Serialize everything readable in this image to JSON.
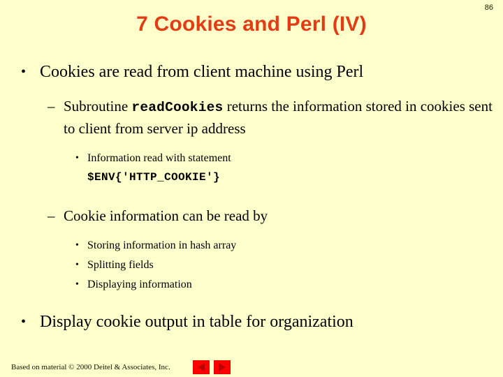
{
  "slide": {
    "page_number": "86",
    "title": "7 Cookies and Perl (IV)",
    "background_color": "#ffffcc",
    "title_color": "#e23c14",
    "text_color": "#000000"
  },
  "content": {
    "bullet1": {
      "marker": "•",
      "text": "Cookies are read from client machine using Perl"
    },
    "bullet1_sub1": {
      "marker": "–",
      "text_before": "Subroutine ",
      "code": "readCookies",
      "text_after": " returns the information stored in cookies sent to client from server ip address"
    },
    "bullet1_sub1_sub1": {
      "marker": "•",
      "text": "Information read with statement"
    },
    "bullet1_sub1_code": {
      "code": "$ENV{'HTTP_COOKIE'}"
    },
    "bullet1_sub2": {
      "marker": "–",
      "text": "Cookie information can be read by"
    },
    "bullet1_sub2_items": [
      {
        "marker": "•",
        "text": "Storing information in hash array"
      },
      {
        "marker": "•",
        "text": "Splitting fields"
      },
      {
        "marker": "•",
        "text": "Displaying information"
      }
    ],
    "bullet2": {
      "marker": "•",
      "text": "Display cookie output in table for organization"
    }
  },
  "footer": {
    "credit": "Based on material © 2000 Deitel & Associates, Inc.",
    "prev_button_icon": "triangle-left",
    "next_button_icon": "triangle-right",
    "button_color": "#fe0000",
    "arrow_color": "#bb0000"
  }
}
